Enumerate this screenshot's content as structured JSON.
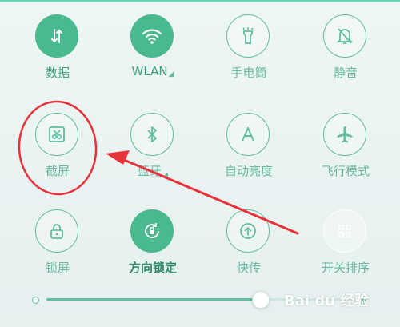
{
  "toggles": [
    {
      "label": "数据",
      "icon": "data-arrows-icon",
      "state": "on"
    },
    {
      "label": "WLAN",
      "icon": "wifi-icon",
      "state": "on",
      "has_caret": true
    },
    {
      "label": "手电筒",
      "icon": "flashlight-icon",
      "state": "off"
    },
    {
      "label": "静音",
      "icon": "bell-off-icon",
      "state": "off"
    },
    {
      "label": "截屏",
      "icon": "scissors-icon",
      "state": "off"
    },
    {
      "label": "蓝牙",
      "icon": "bluetooth-icon",
      "state": "off",
      "has_caret": true
    },
    {
      "label": "自动亮度",
      "icon": "auto-brightness-icon",
      "state": "off"
    },
    {
      "label": "飞行模式",
      "icon": "airplane-icon",
      "state": "off"
    },
    {
      "label": "锁屏",
      "icon": "lock-icon",
      "state": "off"
    },
    {
      "label": "方向锁定",
      "icon": "rotation-lock-icon",
      "state": "on"
    },
    {
      "label": "快传",
      "icon": "quick-transfer-icon",
      "state": "off"
    },
    {
      "label": "开关排序",
      "icon": "grid-icon",
      "state": "off"
    }
  ],
  "brightness": {
    "level": 0.66
  },
  "watermark": "Bai du 经验",
  "colors": {
    "accent": "#49b98e",
    "annotation": "#e8323a"
  }
}
